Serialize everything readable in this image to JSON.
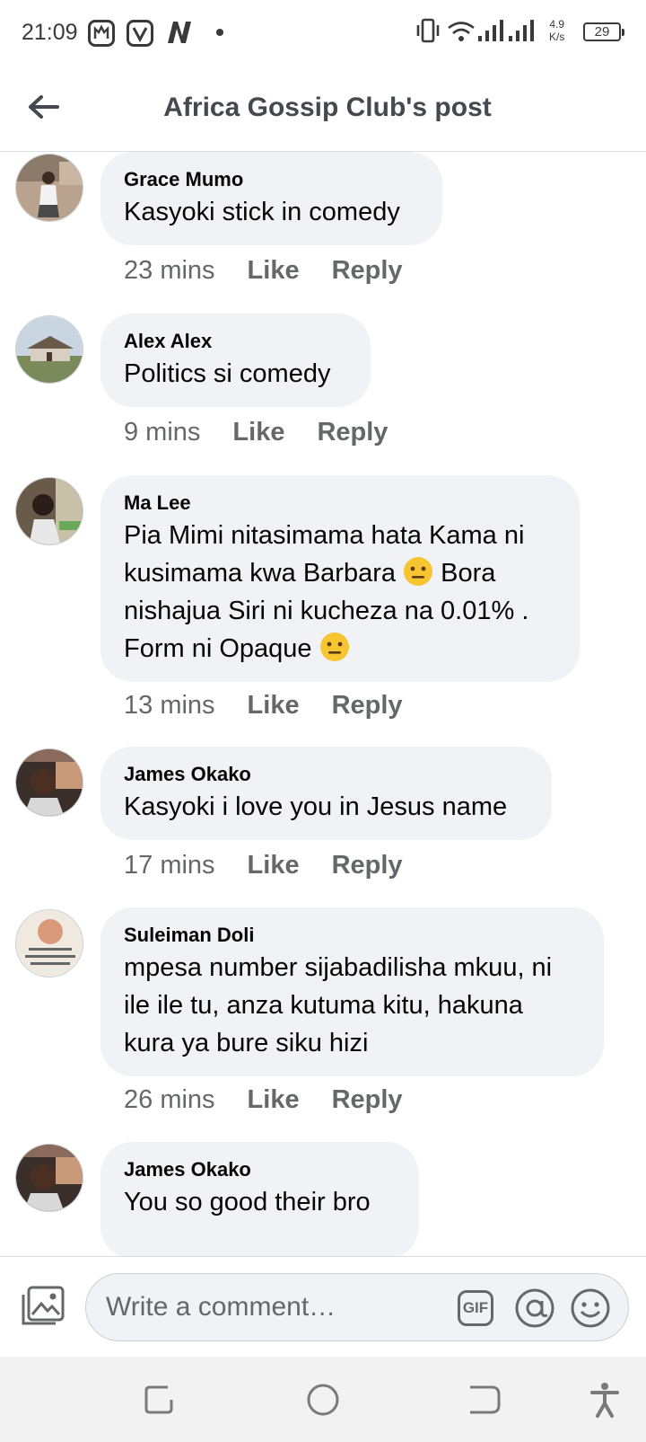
{
  "status_bar": {
    "time": "21:09",
    "app_icons": [
      "gallery-icon",
      "vibe-icon",
      "n-app-icon"
    ],
    "net_speed_value": "4.9",
    "net_speed_unit": "K/s",
    "battery": "29"
  },
  "header": {
    "title": "Africa Gossip Club's post"
  },
  "comments": [
    {
      "author": "Grace Mumo",
      "text": "Kasyoki stick in comedy",
      "time": "23 mins",
      "like": "Like",
      "reply": "Reply"
    },
    {
      "author": "Alex Alex",
      "text": "Politics si comedy",
      "time": "9 mins",
      "like": "Like",
      "reply": "Reply"
    },
    {
      "author": "Ma Lee",
      "line1": "Pia Mimi nitasimama hata Kama ni",
      "line2a": "kusimama kwa Barbara",
      "line2b": " Bora",
      "line3": "nishajua Siri ni kucheza na 0.01% .",
      "line4": "Form ni Opaque",
      "time": "13 mins",
      "like": "Like",
      "reply": "Reply"
    },
    {
      "author": "James Okako",
      "text": "Kasyoki i love you in Jesus name",
      "time": "17 mins",
      "like": "Like",
      "reply": "Reply"
    },
    {
      "author": "Suleiman Doli",
      "line1": "mpesa number sijabadilisha mkuu, ni",
      "line2": "ile ile tu, anza kutuma kitu, hakuna",
      "line3": "kura ya bure siku hizi",
      "time": "26 mins",
      "like": "Like",
      "reply": "Reply"
    },
    {
      "author": "James Okako",
      "text": "You so good their bro"
    }
  ],
  "composer": {
    "placeholder": "Write a comment…",
    "gif_label": "GIF"
  }
}
